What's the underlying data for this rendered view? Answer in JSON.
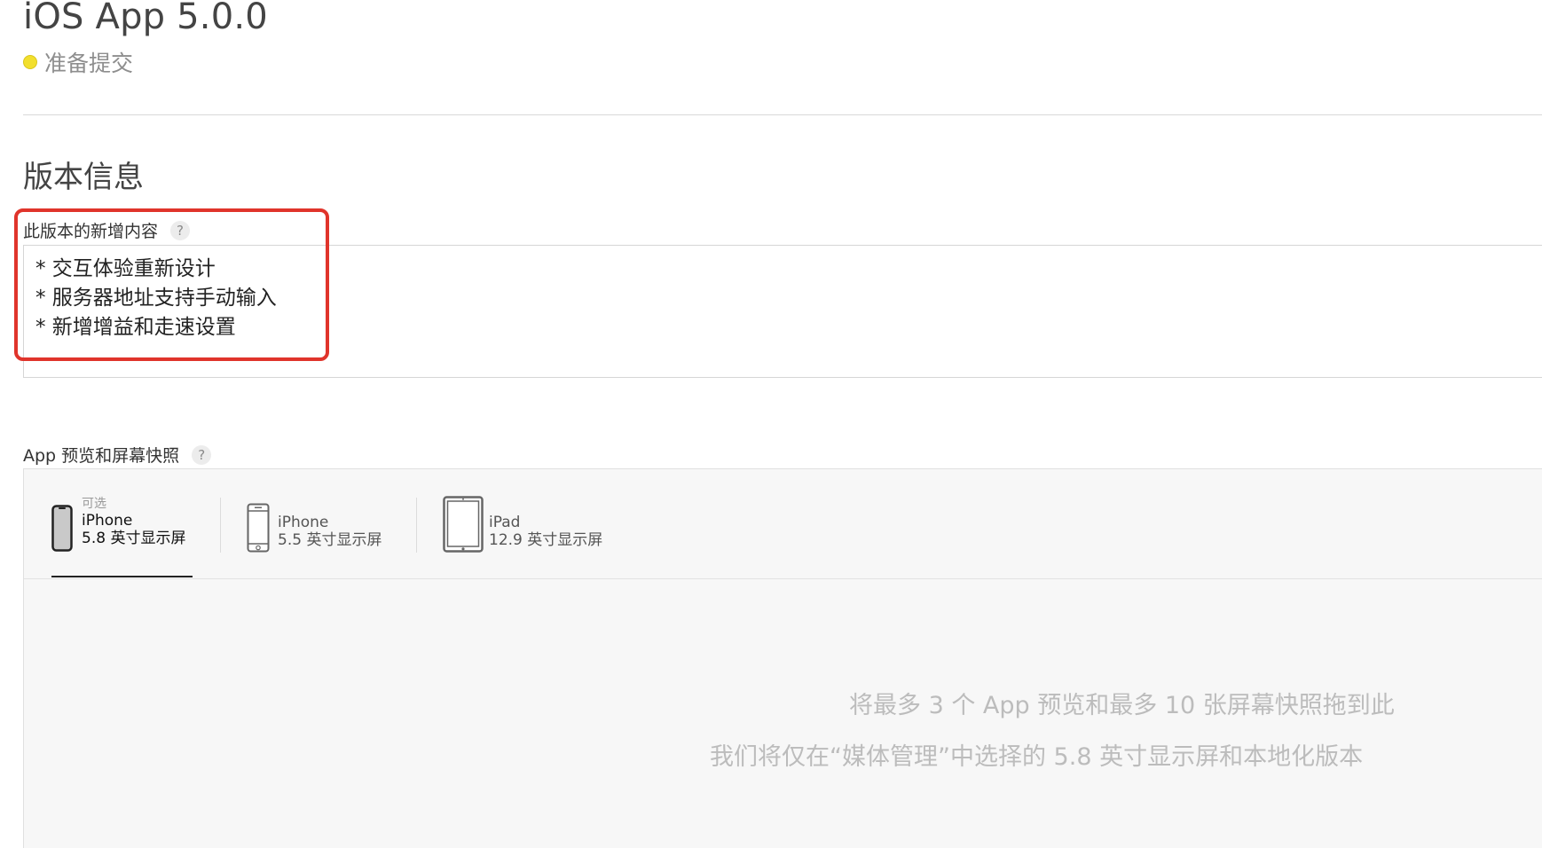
{
  "header": {
    "app_title": "iOS App 5.0.0",
    "status_text": "准备提交",
    "status_color": "#f2df2d"
  },
  "version_info": {
    "section_title": "版本信息",
    "whats_new": {
      "label": "此版本的新增内容",
      "help_glyph": "?",
      "lines": [
        "* 交互体验重新设计",
        "* 服务器地址支持手动输入",
        "* 新增增益和走速设置"
      ]
    }
  },
  "media": {
    "label": "App 预览和屏幕快照",
    "help_glyph": "?",
    "tabs": [
      {
        "optional": "可选",
        "device": "iPhone",
        "size": "5.8 英寸显示屏",
        "icon": "iphone-x-icon",
        "active": true
      },
      {
        "optional": "",
        "device": "iPhone",
        "size": "5.5 英寸显示屏",
        "icon": "iphone-icon",
        "active": false
      },
      {
        "optional": "",
        "device": "iPad",
        "size": "12.9 英寸显示屏",
        "icon": "ipad-icon",
        "active": false
      }
    ],
    "drop_hint_1": "将最多 3 个 App 预览和最多 10 张屏幕快照拖到此",
    "drop_hint_2": "我们将仅在“媒体管理”中选择的 5.8 英寸显示屏和本地化版本"
  },
  "colors": {
    "highlight_border": "#e0342b",
    "panel_bg": "#f7f7f7"
  }
}
